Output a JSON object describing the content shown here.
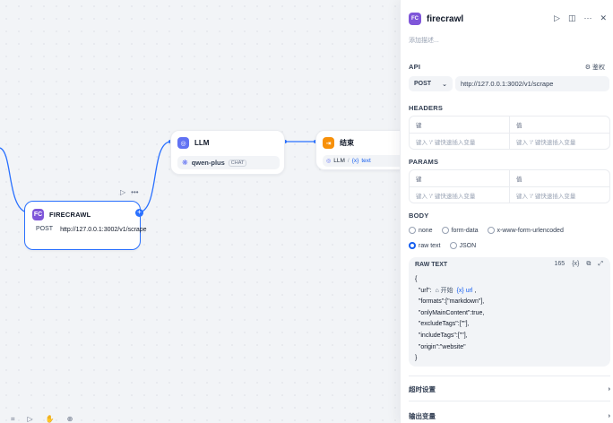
{
  "canvas": {
    "firecrawl_node": {
      "icon": "FC",
      "title": "FIRECRAWL",
      "method": "POST",
      "url": "http://127.0.0.1:3002/v1/scrape",
      "toolbar_run": "▷",
      "toolbar_more": "•••",
      "plus": "+"
    },
    "llm_node": {
      "icon": "◎",
      "title": "LLM",
      "model_icon": "❋",
      "model": "qwen-plus",
      "model_tag": "CHAT"
    },
    "end_node": {
      "icon": "⇥",
      "title": "结束",
      "var_source": "LLM",
      "var_name": "text",
      "var_icon": "{x}"
    },
    "tools": [
      "⌗",
      "▷",
      "✋",
      "⊕"
    ]
  },
  "panel": {
    "icon": "FC",
    "title": "firecrawl",
    "actions": {
      "run": "▷",
      "layout": "◫",
      "more": "···",
      "close": "✕"
    },
    "description_placeholder": "添加描述...",
    "api": {
      "label": "API",
      "auth": "鉴权",
      "method": "POST",
      "url": "http://127.0.0.1:3002/v1/scrape"
    },
    "headers": {
      "label": "HEADERS",
      "col_key": "键",
      "col_value": "值",
      "placeholder": "键入 '/' 键快速插入变量"
    },
    "params": {
      "label": "PARAMS",
      "col_key": "键",
      "col_value": "值",
      "placeholder": "键入 '/' 键快速插入变量"
    },
    "body": {
      "label": "BODY",
      "options": [
        "none",
        "form-data",
        "x-www-form-urlencoded",
        "raw text",
        "JSON"
      ],
      "selected": "raw text"
    },
    "raw_text": {
      "label": "RAW TEXT",
      "count": "165",
      "var_btn": "{x}",
      "copy": "⧉",
      "expand": "⤢",
      "lines": [
        "{",
        "  \"url\":  开始  {x} url  ,",
        "  \"formats\":[\"markdown\"],",
        "  \"onlyMainContent\":true,",
        "  \"excludeTags\":[\"\"],",
        "  \"includeTags\":[\"\"],",
        "  \"origin\":\"website\"",
        "}"
      ],
      "url_prefix": "  \"url\": ",
      "url_node": "开始",
      "url_var": "url",
      "url_suffix": " ,"
    },
    "timeout": {
      "label": "超时设置",
      "chevron": "›"
    },
    "output_vars": {
      "label": "输出变量",
      "chevron": "›"
    }
  }
}
